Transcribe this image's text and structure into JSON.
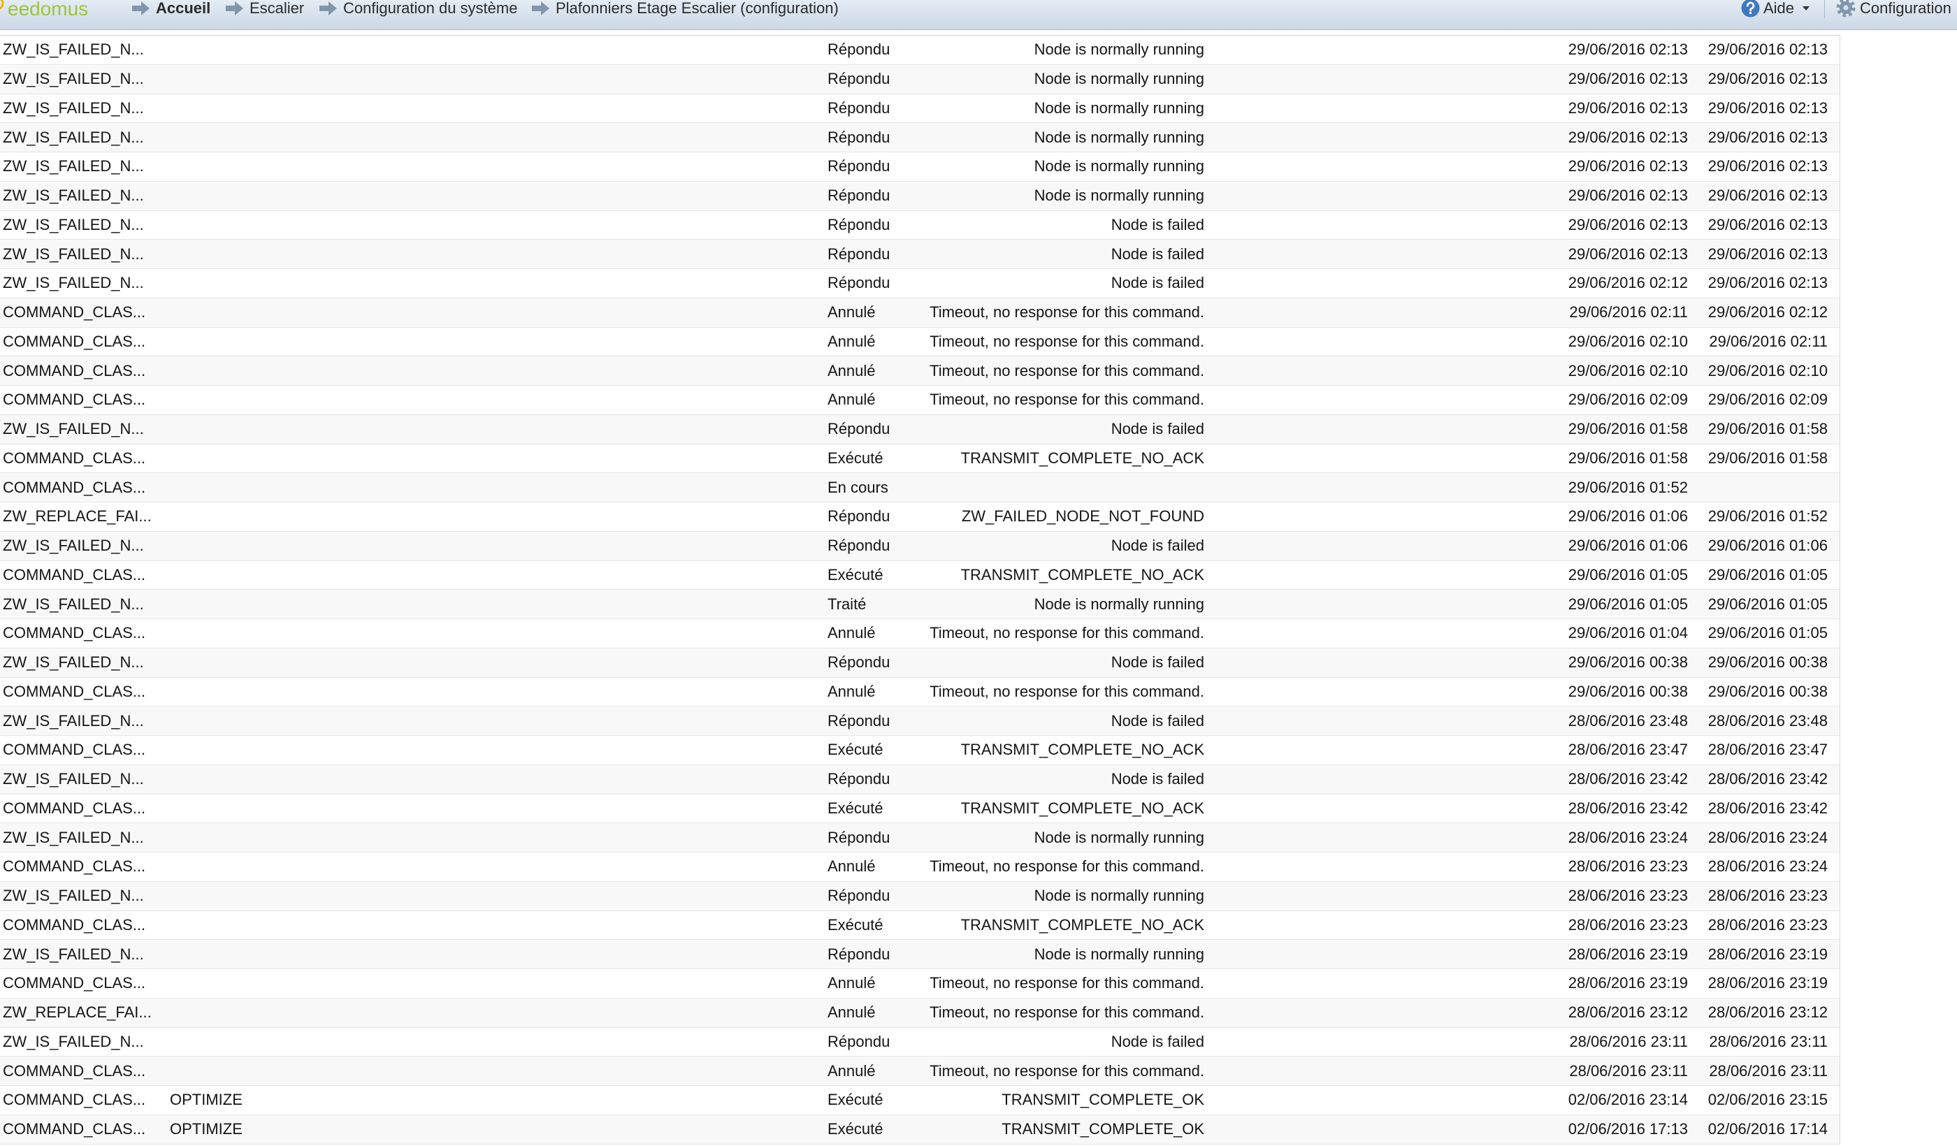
{
  "header": {
    "logo": "eedomus",
    "breadcrumb": [
      "Accueil",
      "Escalier",
      "Configuration du système",
      "Plafonniers Etage Escalier (configuration)"
    ],
    "help_label": "Aide",
    "config_label": "Configuration"
  },
  "icons": {
    "logo_mark": "logo-circle-icon",
    "breadcrumb_separator": "arrow-right-icon",
    "help": "help-icon",
    "dropdown": "caret-down-icon",
    "settings": "gear-icon"
  },
  "theme": {
    "logo": "#9fc43a",
    "header_top": "#e4ecf4",
    "header_bottom": "#cbd8e6",
    "icon": "#8296ab",
    "help": "#3f78c0"
  },
  "rows": [
    {
      "name": "ZW_IS_FAILED_N...",
      "status": "Répondu",
      "result": "Node is normally running",
      "start": "29/06/2016 02:13",
      "end": "29/06/2016 02:13"
    },
    {
      "name": "ZW_IS_FAILED_N...",
      "status": "Répondu",
      "result": "Node is normally running",
      "start": "29/06/2016 02:13",
      "end": "29/06/2016 02:13"
    },
    {
      "name": "ZW_IS_FAILED_N...",
      "status": "Répondu",
      "result": "Node is normally running",
      "start": "29/06/2016 02:13",
      "end": "29/06/2016 02:13"
    },
    {
      "name": "ZW_IS_FAILED_N...",
      "status": "Répondu",
      "result": "Node is normally running",
      "start": "29/06/2016 02:13",
      "end": "29/06/2016 02:13"
    },
    {
      "name": "ZW_IS_FAILED_N...",
      "status": "Répondu",
      "result": "Node is normally running",
      "start": "29/06/2016 02:13",
      "end": "29/06/2016 02:13"
    },
    {
      "name": "ZW_IS_FAILED_N...",
      "status": "Répondu",
      "result": "Node is normally running",
      "start": "29/06/2016 02:13",
      "end": "29/06/2016 02:13"
    },
    {
      "name": "ZW_IS_FAILED_N...",
      "status": "Répondu",
      "result": "Node is failed",
      "start": "29/06/2016 02:13",
      "end": "29/06/2016 02:13"
    },
    {
      "name": "ZW_IS_FAILED_N...",
      "status": "Répondu",
      "result": "Node is failed",
      "start": "29/06/2016 02:13",
      "end": "29/06/2016 02:13"
    },
    {
      "name": "ZW_IS_FAILED_N...",
      "status": "Répondu",
      "result": "Node is failed",
      "start": "29/06/2016 02:12",
      "end": "29/06/2016 02:13"
    },
    {
      "name": "COMMAND_CLAS...",
      "status": "Annulé",
      "result": "Timeout, no response for this command.",
      "start": "29/06/2016 02:11",
      "end": "29/06/2016 02:12"
    },
    {
      "name": "COMMAND_CLAS...",
      "status": "Annulé",
      "result": "Timeout, no response for this command.",
      "start": "29/06/2016 02:10",
      "end": "29/06/2016 02:11"
    },
    {
      "name": "COMMAND_CLAS...",
      "status": "Annulé",
      "result": "Timeout, no response for this command.",
      "start": "29/06/2016 02:10",
      "end": "29/06/2016 02:10"
    },
    {
      "name": "COMMAND_CLAS...",
      "status": "Annulé",
      "result": "Timeout, no response for this command.",
      "start": "29/06/2016 02:09",
      "end": "29/06/2016 02:09"
    },
    {
      "name": "ZW_IS_FAILED_N...",
      "status": "Répondu",
      "result": "Node is failed",
      "start": "29/06/2016 01:58",
      "end": "29/06/2016 01:58"
    },
    {
      "name": "COMMAND_CLAS...",
      "status": "Exécuté",
      "result": "TRANSMIT_COMPLETE_NO_ACK",
      "start": "29/06/2016 01:58",
      "end": "29/06/2016 01:58"
    },
    {
      "name": "COMMAND_CLAS...",
      "status": "En cours",
      "start": "29/06/2016 01:52"
    },
    {
      "name": "ZW_REPLACE_FAI...",
      "status": "Répondu",
      "result": "ZW_FAILED_NODE_NOT_FOUND",
      "start": "29/06/2016 01:06",
      "end": "29/06/2016 01:52"
    },
    {
      "name": "ZW_IS_FAILED_N...",
      "status": "Répondu",
      "result": "Node is failed",
      "start": "29/06/2016 01:06",
      "end": "29/06/2016 01:06"
    },
    {
      "name": "COMMAND_CLAS...",
      "status": "Exécuté",
      "result": "TRANSMIT_COMPLETE_NO_ACK",
      "start": "29/06/2016 01:05",
      "end": "29/06/2016 01:05"
    },
    {
      "name": "ZW_IS_FAILED_N...",
      "status": "Traité",
      "result": "Node is normally running",
      "start": "29/06/2016 01:05",
      "end": "29/06/2016 01:05"
    },
    {
      "name": "COMMAND_CLAS...",
      "status": "Annulé",
      "result": "Timeout, no response for this command.",
      "start": "29/06/2016 01:04",
      "end": "29/06/2016 01:05"
    },
    {
      "name": "ZW_IS_FAILED_N...",
      "status": "Répondu",
      "result": "Node is failed",
      "start": "29/06/2016 00:38",
      "end": "29/06/2016 00:38"
    },
    {
      "name": "COMMAND_CLAS...",
      "status": "Annulé",
      "result": "Timeout, no response for this command.",
      "start": "29/06/2016 00:38",
      "end": "29/06/2016 00:38"
    },
    {
      "name": "ZW_IS_FAILED_N...",
      "status": "Répondu",
      "result": "Node is failed",
      "start": "28/06/2016 23:48",
      "end": "28/06/2016 23:48"
    },
    {
      "name": "COMMAND_CLAS...",
      "status": "Exécuté",
      "result": "TRANSMIT_COMPLETE_NO_ACK",
      "start": "28/06/2016 23:47",
      "end": "28/06/2016 23:47"
    },
    {
      "name": "ZW_IS_FAILED_N...",
      "status": "Répondu",
      "result": "Node is failed",
      "start": "28/06/2016 23:42",
      "end": "28/06/2016 23:42"
    },
    {
      "name": "COMMAND_CLAS...",
      "status": "Exécuté",
      "result": "TRANSMIT_COMPLETE_NO_ACK",
      "start": "28/06/2016 23:42",
      "end": "28/06/2016 23:42"
    },
    {
      "name": "ZW_IS_FAILED_N...",
      "status": "Répondu",
      "result": "Node is normally running",
      "start": "28/06/2016 23:24",
      "end": "28/06/2016 23:24"
    },
    {
      "name": "COMMAND_CLAS...",
      "status": "Annulé",
      "result": "Timeout, no response for this command.",
      "start": "28/06/2016 23:23",
      "end": "28/06/2016 23:24"
    },
    {
      "name": "ZW_IS_FAILED_N...",
      "status": "Répondu",
      "result": "Node is normally running",
      "start": "28/06/2016 23:23",
      "end": "28/06/2016 23:23"
    },
    {
      "name": "COMMAND_CLAS...",
      "status": "Exécuté",
      "result": "TRANSMIT_COMPLETE_NO_ACK",
      "start": "28/06/2016 23:23",
      "end": "28/06/2016 23:23"
    },
    {
      "name": "ZW_IS_FAILED_N...",
      "status": "Répondu",
      "result": "Node is normally running",
      "start": "28/06/2016 23:19",
      "end": "28/06/2016 23:19"
    },
    {
      "name": "COMMAND_CLAS...",
      "status": "Annulé",
      "result": "Timeout, no response for this command.",
      "start": "28/06/2016 23:19",
      "end": "28/06/2016 23:19"
    },
    {
      "name": "ZW_REPLACE_FAI...",
      "status": "Annulé",
      "result": "Timeout, no response for this command.",
      "start": "28/06/2016 23:12",
      "end": "28/06/2016 23:12"
    },
    {
      "name": "ZW_IS_FAILED_N...",
      "status": "Répondu",
      "result": "Node is failed",
      "start": "28/06/2016 23:11",
      "end": "28/06/2016 23:11"
    },
    {
      "name": "COMMAND_CLAS...",
      "status": "Annulé",
      "result": "Timeout, no response for this command.",
      "start": "28/06/2016 23:11",
      "end": "28/06/2016 23:11"
    },
    {
      "name": "COMMAND_CLAS...",
      "command": "OPTIMIZE",
      "status": "Exécuté",
      "result": "TRANSMIT_COMPLETE_OK",
      "start": "02/06/2016 23:14",
      "end": "02/06/2016 23:15"
    },
    {
      "name": "COMMAND_CLAS...",
      "command": "OPTIMIZE",
      "status": "Exécuté",
      "result": "TRANSMIT_COMPLETE_OK",
      "start": "02/06/2016 17:13",
      "end": "02/06/2016 17:14"
    }
  ]
}
